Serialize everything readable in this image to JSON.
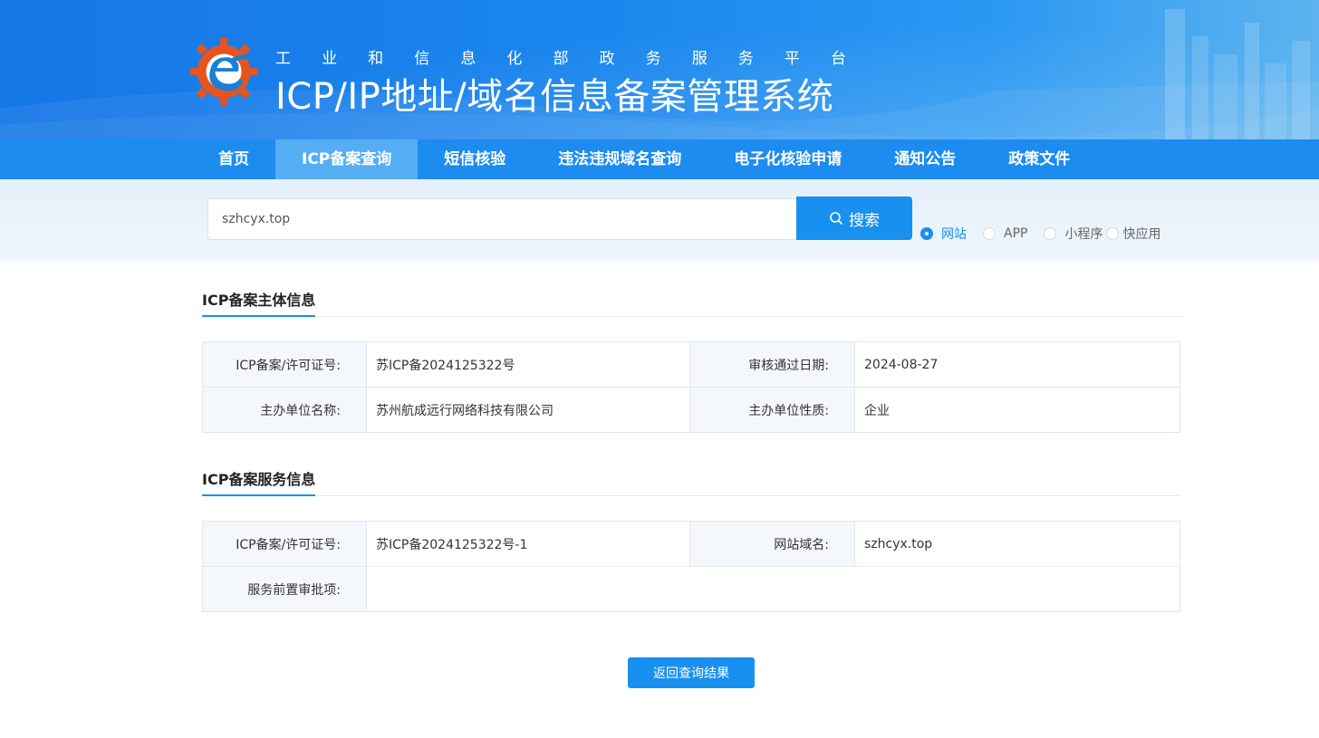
{
  "header": {
    "subtitle_chars": [
      "工",
      "业",
      "和",
      "信",
      "息",
      "化",
      "部",
      "政",
      "务",
      "服",
      "务",
      "平",
      "台"
    ],
    "title": "ICP/IP地址/域名信息备案管理系统",
    "logo_icon": "gear-e-logo"
  },
  "nav": {
    "items": [
      {
        "label": "首页"
      },
      {
        "label": "ICP备案查询",
        "active": true
      },
      {
        "label": "短信核验"
      },
      {
        "label": "违法违规域名查询"
      },
      {
        "label": "电子化核验申请"
      },
      {
        "label": "通知公告"
      },
      {
        "label": "政策文件"
      }
    ]
  },
  "search": {
    "value": "szhcyx.top",
    "button_label": "搜索",
    "button_icon": "search-icon",
    "types": [
      {
        "label": "网站",
        "checked": true
      },
      {
        "label": "APP",
        "checked": false
      },
      {
        "label": "小程序",
        "checked": false
      },
      {
        "label": "快应用",
        "checked": false
      }
    ]
  },
  "subject_info": {
    "title": "ICP备案主体信息",
    "license_label": "ICP备案/许可证号:",
    "license_value": "苏ICP备2024125322号",
    "date_label": "审核通过日期:",
    "date_value": "2024-08-27",
    "org_label": "主办单位名称:",
    "org_value": "苏州航成远行网络科技有限公司",
    "nature_label": "主办单位性质:",
    "nature_value": "企业"
  },
  "service_info": {
    "title": "ICP备案服务信息",
    "license_label": "ICP备案/许可证号:",
    "license_value": "苏ICP备2024125322号-1",
    "domain_label": "网站域名:",
    "domain_value": "szhcyx.top",
    "approval_label": "服务前置审批项:",
    "approval_value": ""
  },
  "actions": {
    "back_label": "返回查询结果"
  },
  "colors": {
    "primary": "#1890f0",
    "nav_bg": "#1c8cf0",
    "nav_active": "#55adf4"
  }
}
